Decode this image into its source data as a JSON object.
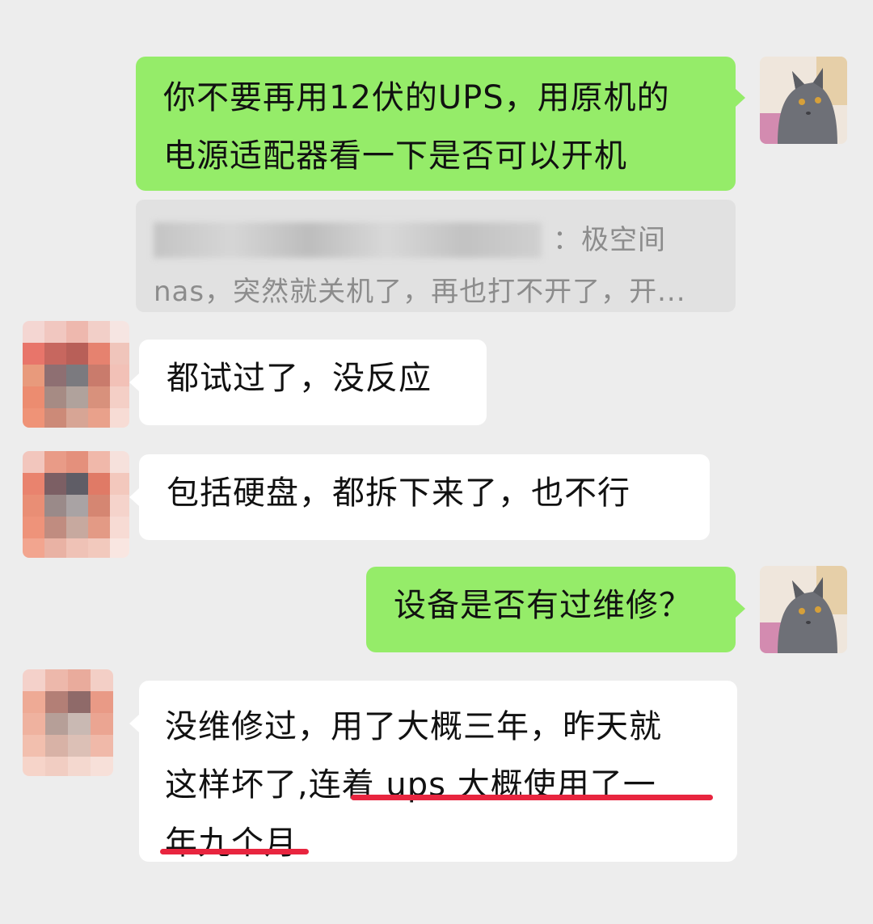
{
  "messages": [
    {
      "side": "right",
      "lines": [
        "你不要再用12伏的UPS，用原机的",
        "电源适配器看一下是否可以开机"
      ],
      "quote": {
        "suffix": "：极空间",
        "line2": "nas，突然就关机了，再也打不开了，开..."
      }
    },
    {
      "side": "left",
      "text": "都试过了，没反应"
    },
    {
      "side": "left",
      "text": "包括硬盘，都拆下来了，也不行"
    },
    {
      "side": "right",
      "text": "设备是否有过维修？"
    },
    {
      "side": "left",
      "line1": "没维修过，用了大概三年，昨天就",
      "line2_a": "这样坏了,",
      "line2_b": "连着 ups 大概使用了一",
      "line3": "年九个月"
    }
  ],
  "colors": {
    "background": "#ededed",
    "sent_bubble": "#95ec69",
    "received_bubble": "#ffffff",
    "quote_bg": "#e1e1e1",
    "annotation_underline": "#e8253f"
  },
  "icons": {
    "self_avatar": "gray-cat-avatar",
    "peer_avatar": "pixelated-avatar"
  }
}
